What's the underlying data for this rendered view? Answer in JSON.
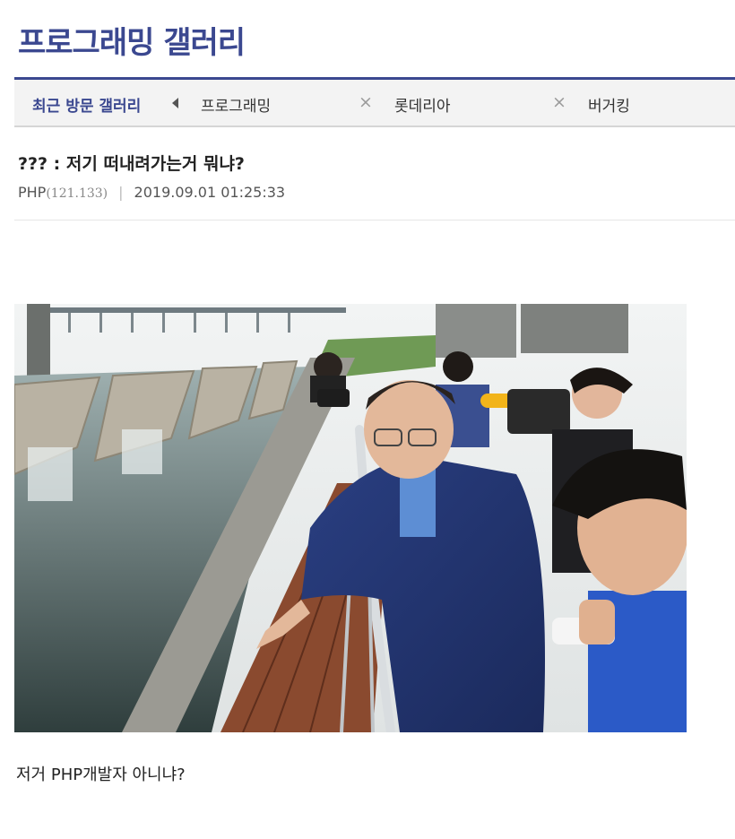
{
  "gallery": {
    "title": "프로그래밍 갤러리"
  },
  "recent_visits": {
    "label": "최근 방문 갤러리",
    "items": [
      {
        "label": "프로그래밍"
      },
      {
        "label": "롯데리아"
      },
      {
        "label": "버거킹"
      }
    ],
    "close_glyph": "×"
  },
  "post": {
    "title": "??? : 저기 떠내려가는거 뭐냐?",
    "author": "PHP",
    "ip": "(121.133)",
    "separator": "|",
    "datetime": "2019.09.01 01:25:33",
    "body": "저거 PHP개발자 아니냐?"
  },
  "colors": {
    "accent": "#3b4890",
    "bar_bg": "#f3f3f3"
  }
}
